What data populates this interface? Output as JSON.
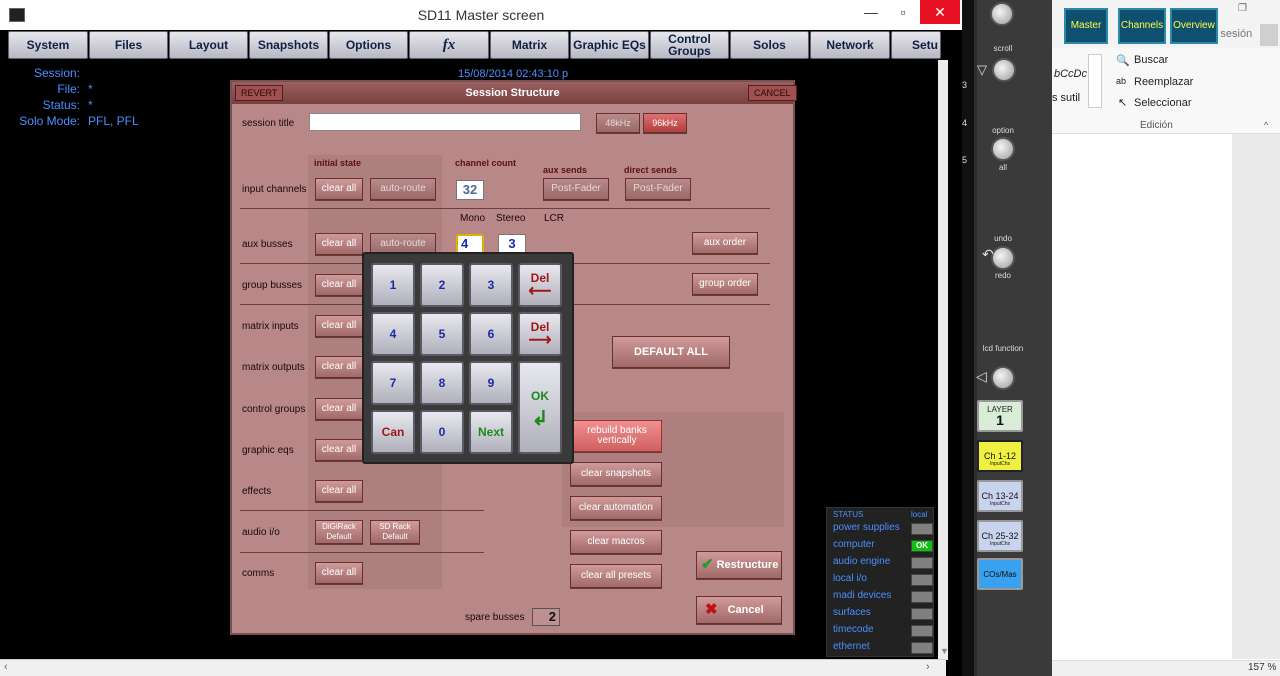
{
  "app": {
    "title": "SD11 Master screen",
    "minimize": "—",
    "restore": "▫",
    "close": "✕"
  },
  "menu": {
    "items": [
      "System",
      "Files",
      "Layout",
      "Snapshots",
      "Options",
      "fx",
      "Matrix",
      "Graphic EQs",
      "Control Groups",
      "Solos",
      "Network",
      "Setu"
    ]
  },
  "info": {
    "session_label": "Session:",
    "file_label": "File:",
    "file_value": "*",
    "status_label": "Status:",
    "status_value": "*",
    "solo_label": "Solo Mode:",
    "solo_value": "PFL, PFL",
    "datetime": "15/08/2014 02:43:10 p"
  },
  "dialog": {
    "title": "Session Structure",
    "revert": "REVERT",
    "cancel_top": "CANCEL",
    "session_title_label": "session title",
    "session_title_value": "",
    "rate_48": "48kHz",
    "rate_96": "96kHz",
    "initial_state": "initial state",
    "channel_count": "channel count",
    "aux_sends": "aux sends",
    "direct_sends": "direct sends",
    "mono": "Mono",
    "stereo": "Stereo",
    "lcr": "LCR",
    "channel_count_value": "32",
    "mono_value": "4",
    "stereo_value": "3",
    "clear_all": "clear all",
    "auto_route": "auto-route",
    "post_fader": "Post-Fader",
    "aux_order": "aux order",
    "group_order": "group order",
    "default_all": "DEFAULT ALL",
    "rebuild_banks": "rebuild banks vertically",
    "clear_snapshots": "clear snapshots",
    "clear_automation": "clear automation",
    "clear_macros": "clear macros",
    "clear_all_presets": "clear all presets",
    "restructure": "Restructure",
    "cancel": "Cancel",
    "spare_busses_label": "spare busses",
    "spare_busses_value": "2",
    "digirack": "DiGiRack Default",
    "sdrack": "SD Rack Default",
    "rows": [
      "input channels",
      "aux busses",
      "group busses",
      "matrix inputs",
      "matrix outputs",
      "control groups",
      "graphic eqs",
      "effects",
      "audio i/o",
      "comms"
    ]
  },
  "keypad": {
    "keys": [
      "1",
      "2",
      "3",
      "Del ←",
      "4",
      "5",
      "6",
      "Del →",
      "7",
      "8",
      "9",
      "OK",
      "Can",
      "0",
      "Next"
    ]
  },
  "status_panel": {
    "title": "STATUS",
    "local": "local",
    "items": [
      {
        "name": "power supplies",
        "state": ""
      },
      {
        "name": "computer",
        "state": "OK"
      },
      {
        "name": "audio engine",
        "state": ""
      },
      {
        "name": "local i/o",
        "state": ""
      },
      {
        "name": "madi devices",
        "state": ""
      },
      {
        "name": "surfaces",
        "state": ""
      },
      {
        "name": "timecode",
        "state": ""
      },
      {
        "name": "ethernet",
        "state": ""
      }
    ]
  },
  "side_panel": {
    "scroll": "scroll",
    "option": "option",
    "all": "all",
    "undo": "undo",
    "redo": "redo",
    "lcd_function": "lcd function",
    "layer": "LAYER",
    "layer_num": "1",
    "tiles": [
      "Ch 1-12",
      "Ch 13-24",
      "Ch 25-32",
      "COs/Mas"
    ],
    "tile_sub": "InputChs",
    "edge_nums": [
      "3",
      "3",
      "4",
      "5"
    ]
  },
  "word": {
    "tabs": [
      "Master",
      "Channels",
      "Overview"
    ],
    "signin": "Iniciar sesión",
    "style_fragment": "bCcDc",
    "style_fragment2": "s sutil",
    "buscar": "Buscar",
    "reemplazar": "Reemplazar",
    "seleccionar": "Seleccionar",
    "edicion": "Edición",
    "zoom": "157 %"
  }
}
